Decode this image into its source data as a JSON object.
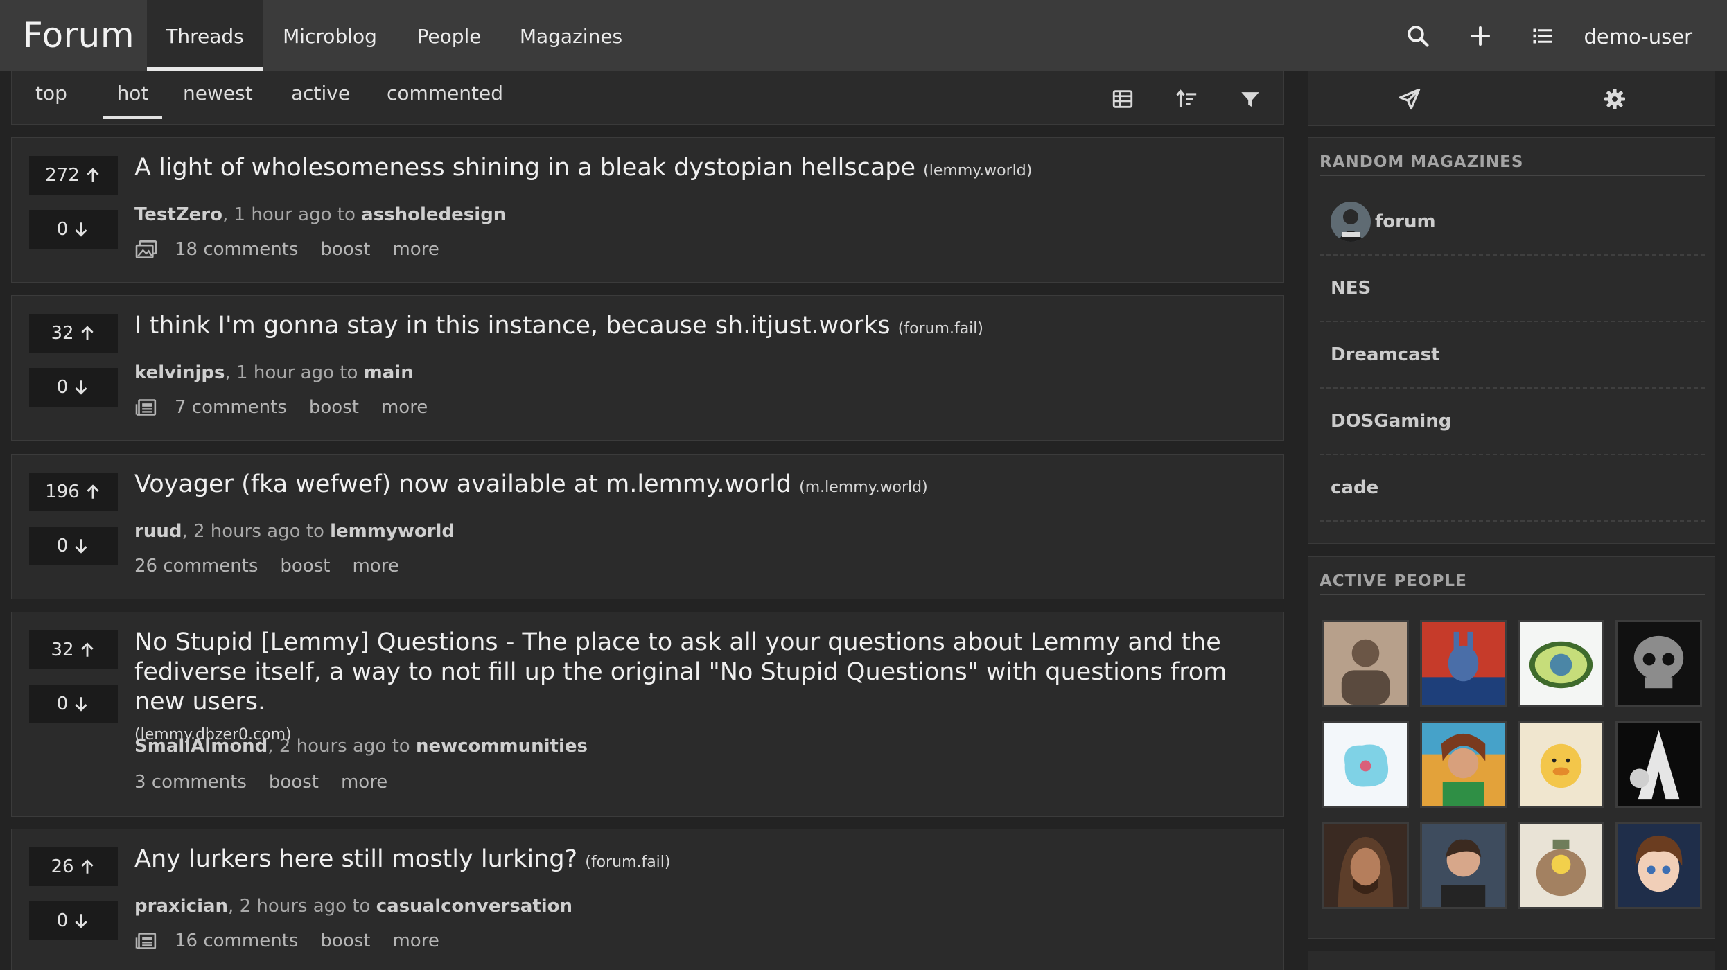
{
  "header": {
    "brand": "Forum",
    "tabs": [
      {
        "label": "Threads",
        "active": true
      },
      {
        "label": "Microblog",
        "active": false
      },
      {
        "label": "People",
        "active": false
      },
      {
        "label": "Magazines",
        "active": false
      }
    ],
    "icons": [
      "search-icon",
      "plus-icon",
      "list-icon"
    ],
    "user": "demo-user"
  },
  "sort": {
    "tabs": [
      {
        "label": "top"
      },
      {
        "label": "hot",
        "active": true
      },
      {
        "label": "newest"
      },
      {
        "label": "active"
      },
      {
        "label": "commented"
      }
    ],
    "icons": [
      "table-view-icon",
      "sort-icon",
      "filter-icon"
    ]
  },
  "posts": [
    {
      "up": "272",
      "down": "0",
      "title": "A light of wholesomeness shining in a bleak dystopian hellscape",
      "domain": "(lemmy.world)",
      "author": "TestZero",
      "time": ", 1 hour ago to ",
      "magazine": "assholedesign",
      "comments": "18 comments",
      "boost": "boost",
      "more": "more",
      "icon": "image-icon"
    },
    {
      "up": "32",
      "down": "0",
      "title": "I think I'm gonna stay in this instance, because sh.itjust.works",
      "domain": "(forum.fail)",
      "author": "kelvinjps",
      "time": ", 1 hour ago to ",
      "magazine": "main",
      "comments": "7 comments",
      "boost": "boost",
      "more": "more",
      "icon": "article-icon"
    },
    {
      "up": "196",
      "down": "0",
      "title": "Voyager (fka wefwef) now available at m.lemmy.world",
      "domain": "(m.lemmy.world)",
      "author": "ruud",
      "time": ", 2 hours ago to ",
      "magazine": "lemmyworld",
      "comments": "26 comments",
      "boost": "boost",
      "more": "more"
    },
    {
      "up": "32",
      "down": "0",
      "title": "No Stupid [Lemmy] Questions - The place to ask all your questions about Lemmy and the fediverse itself, a way to not fill up the original \"No Stupid Questions\" with questions from new users.",
      "domain": "(lemmy.dbzer0.com)",
      "author": "SmallAlmond",
      "time": ", 2 hours ago to ",
      "magazine": "newcommunities",
      "comments": "3 comments",
      "boost": "boost",
      "more": "more"
    },
    {
      "up": "26",
      "down": "0",
      "title": "Any lurkers here still mostly lurking?",
      "domain": "(forum.fail)",
      "author": "praxician",
      "time": ", 2 hours ago to ",
      "magazine": "casualconversation",
      "comments": "16 comments",
      "boost": "boost",
      "more": "more",
      "icon": "article-icon"
    }
  ],
  "sidebar": {
    "icons": [
      "send-icon",
      "gear-icon"
    ],
    "random_magazines": {
      "heading": "RANDOM MAGAZINES",
      "items": [
        "forum",
        "NES",
        "Dreamcast",
        "DOSGaming",
        "cade"
      ]
    },
    "active_people": {
      "heading": "ACTIVE PEOPLE",
      "count": 12
    }
  },
  "colors": {
    "background": "#232323",
    "header": "#3b3b3b",
    "panel": "#2b2b2b",
    "vote_box": "#1b1b1b"
  }
}
